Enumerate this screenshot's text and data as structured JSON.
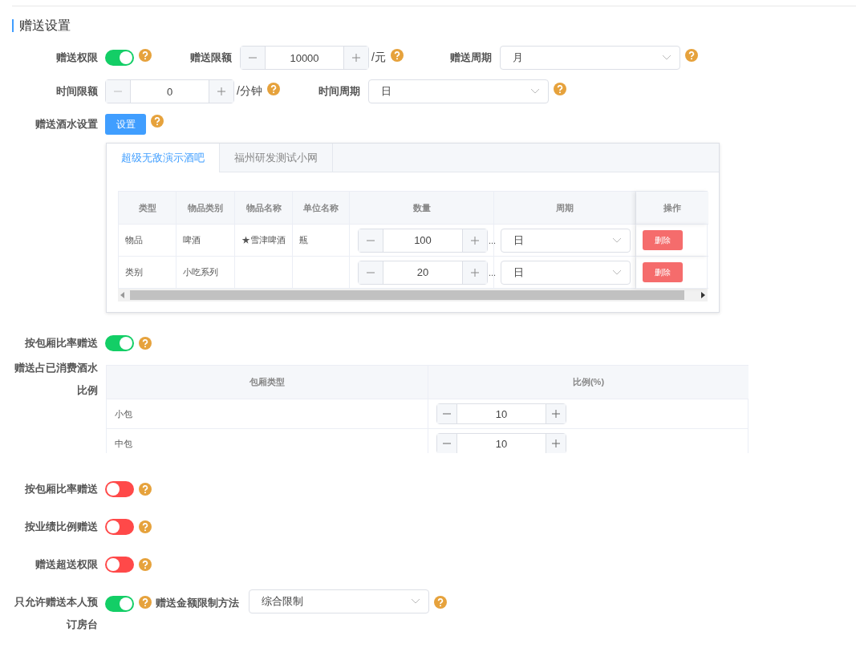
{
  "section_title": "赠送设置",
  "row_1": {
    "permission": {
      "label": "赠送权限",
      "on": true
    },
    "limit": {
      "label": "赠送限额",
      "value": "10000",
      "unit": "/元"
    },
    "cycle": {
      "label": "赠送周期",
      "value": "月"
    }
  },
  "row_2": {
    "time_limit": {
      "label": "时间限额",
      "value": "0",
      "unit": "/分钟"
    },
    "time_cycle": {
      "label": "时间周期",
      "value": "日"
    }
  },
  "drinks": {
    "label": "赠送酒水设置",
    "button": "设置"
  },
  "tabs": [
    {
      "label": "超级无敌演示酒吧",
      "selected": true
    },
    {
      "label": "福州研发测试小网",
      "selected": false
    }
  ],
  "drink_table": {
    "columns": [
      "类型",
      "物品类别",
      "物品名称",
      "单位名称",
      "数量",
      "周期",
      "操作"
    ],
    "rows": [
      {
        "type": "物品",
        "category": "啤酒",
        "name": "★雪津啤酒",
        "unit": "瓶",
        "quantity": "100",
        "overflow": "...",
        "period": "日",
        "action": "删除"
      },
      {
        "type": "类别",
        "category": "小吃系列",
        "name": "",
        "unit": "",
        "quantity": "20",
        "overflow": "...",
        "period": "日",
        "action": "删除"
      }
    ]
  },
  "room_ratio_switch": {
    "label": "按包厢比率赠送",
    "on": true
  },
  "ratio": {
    "label": "赠送占已消费酒水比例",
    "columns": [
      "包厢类型",
      "比例(%)"
    ],
    "rows": [
      {
        "room": "小包",
        "value": "10"
      },
      {
        "room": "中包",
        "value": "10"
      }
    ]
  },
  "switches": [
    {
      "label": "按包厢比率赠送",
      "on": false
    },
    {
      "label": "按业绩比例赠送",
      "on": false
    },
    {
      "label": "赠送超送权限",
      "on": false
    }
  ],
  "last_row": {
    "switch": {
      "label": "只允许赠送本人预订房台",
      "on": true
    },
    "method": {
      "label": "赠送金额限制方法",
      "value": "综合限制"
    }
  }
}
